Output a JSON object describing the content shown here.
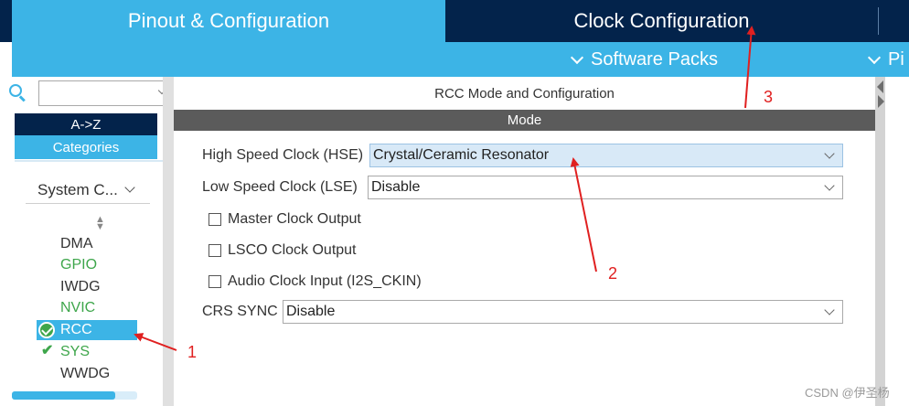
{
  "tabs": {
    "pinout": "Pinout & Configuration",
    "clock": "Clock Configuration"
  },
  "subbar": {
    "software_packs": "Software Packs",
    "pinout": "Pi"
  },
  "left_panel": {
    "search_value": "",
    "sort_button": "A->Z",
    "categories_button": "Categories",
    "category_dropdown": "System C...",
    "peripherals": [
      {
        "label": "DMA",
        "status": "none",
        "color": "#333333"
      },
      {
        "label": "GPIO",
        "status": "none",
        "color": "#3ea64b"
      },
      {
        "label": "IWDG",
        "status": "none",
        "color": "#333333"
      },
      {
        "label": "NVIC",
        "status": "none",
        "color": "#3ea64b"
      },
      {
        "label": "RCC",
        "status": "configured-selected",
        "color": "#ffffff"
      },
      {
        "label": "SYS",
        "status": "configured",
        "color": "#3ea64b"
      },
      {
        "label": "WWDG",
        "status": "none",
        "color": "#333333"
      }
    ]
  },
  "main": {
    "title": "RCC Mode and Configuration",
    "mode_header": "Mode",
    "hse": {
      "label": "High Speed Clock (HSE)",
      "value": "Crystal/Ceramic Resonator"
    },
    "lse": {
      "label": "Low Speed Clock (LSE)",
      "value": "Disable"
    },
    "checkboxes": [
      {
        "label": "Master Clock Output",
        "checked": false
      },
      {
        "label": "LSCO Clock Output",
        "checked": false
      },
      {
        "label": "Audio Clock Input (I2S_CKIN)",
        "checked": false
      }
    ],
    "crs": {
      "label": "CRS SYNC",
      "value": "Disable"
    }
  },
  "annotations": [
    "1",
    "2",
    "3"
  ],
  "watermark": "CSDN @伊圣杨",
  "colors": {
    "tab_active": "#3cb4e6",
    "tab_inactive": "#03234b",
    "mode_header": "#5b5b5b",
    "annotation_red": "#e02020",
    "status_green": "#3ea64b"
  }
}
